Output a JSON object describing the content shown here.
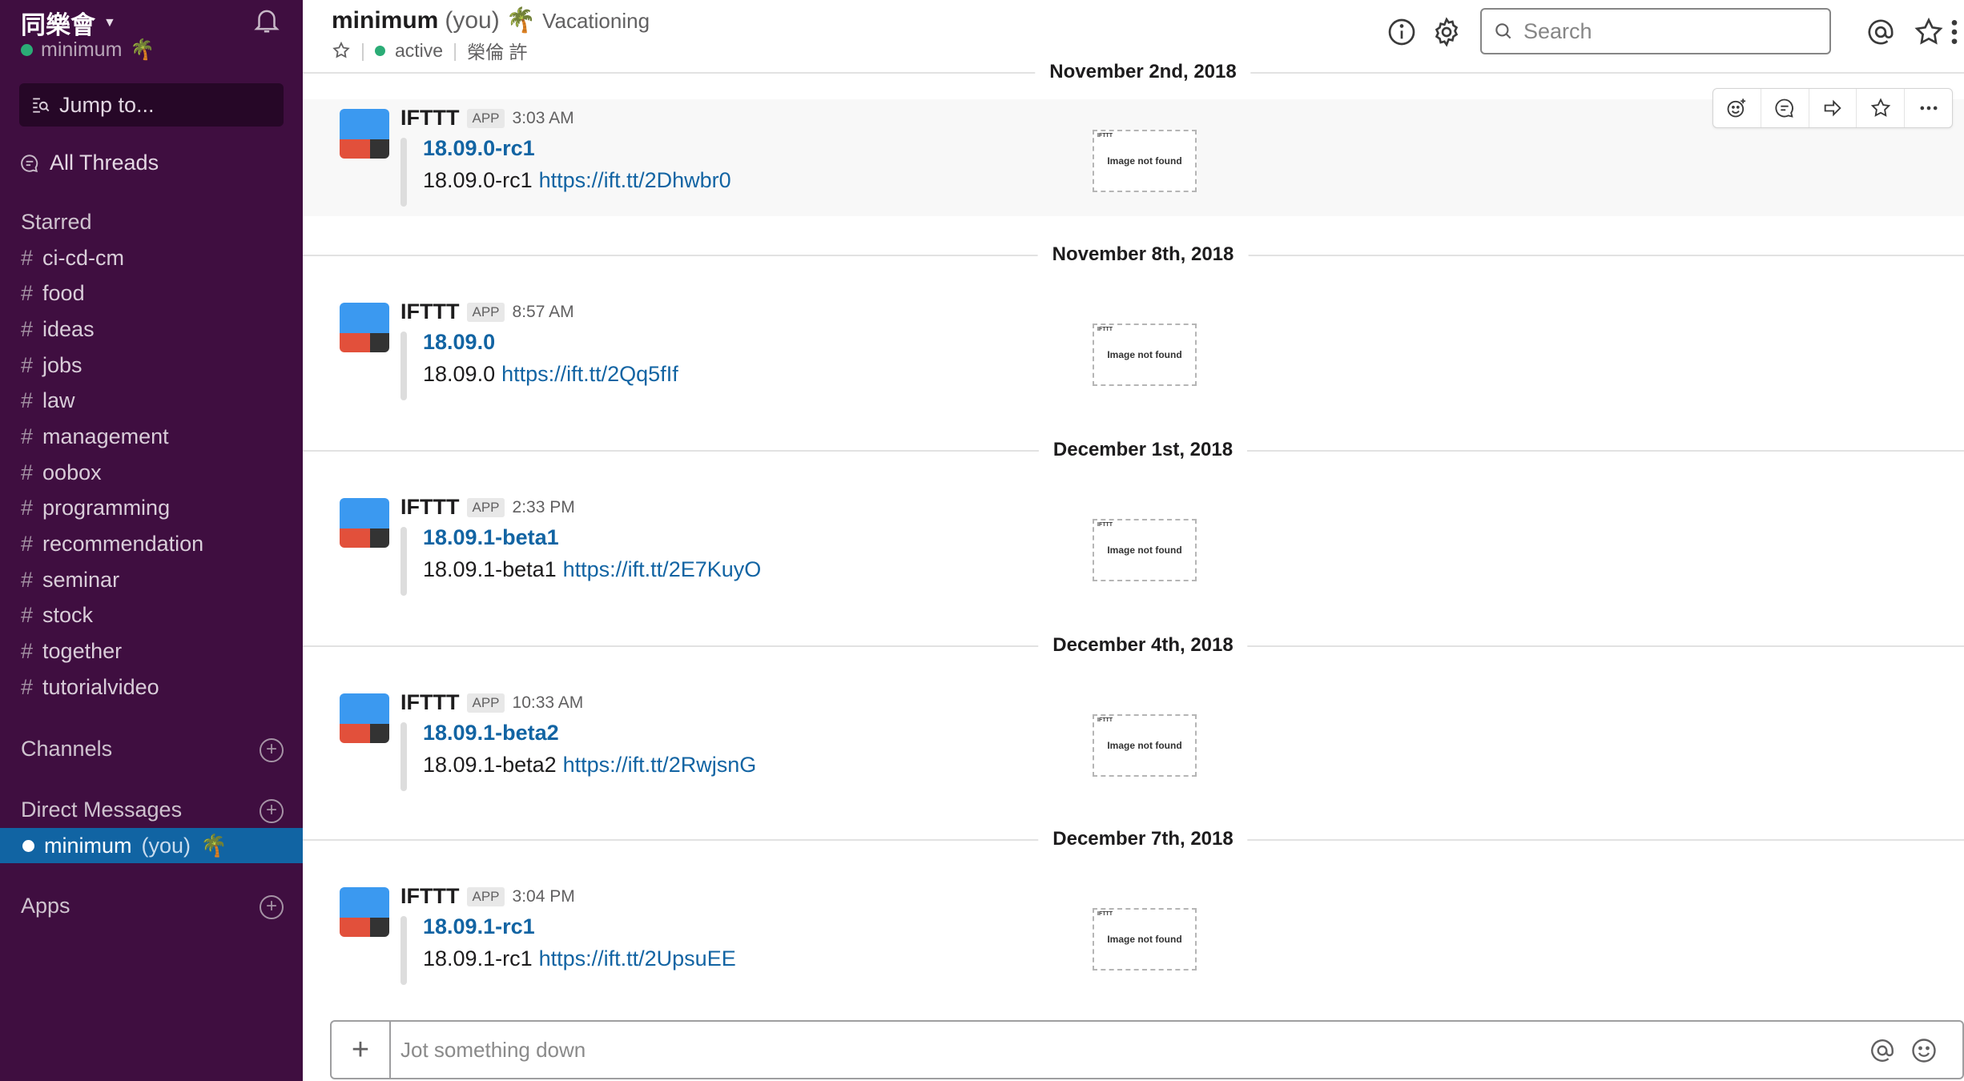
{
  "sidebar": {
    "team_name": "同樂會",
    "user": "minimum",
    "user_emoji": "🌴",
    "jump_to": "Jump to...",
    "all_threads": "All Threads",
    "starred_title": "Starred",
    "starred_channels": [
      "ci-cd-cm",
      "food",
      "ideas",
      "jobs",
      "law",
      "management",
      "oobox",
      "programming",
      "recommendation",
      "seminar",
      "stock",
      "together",
      "tutorialvideo"
    ],
    "channels_title": "Channels",
    "dm_title": "Direct Messages",
    "dm_active_name": "minimum",
    "dm_active_you": "(you)",
    "dm_active_emoji": "🌴",
    "apps_title": "Apps",
    "colors": {
      "background": "#3f0e40",
      "active_item": "#1164a3",
      "presence": "#2bac76"
    }
  },
  "header": {
    "channel_name": "minimum",
    "you": "(you)",
    "status_emoji": "🌴",
    "status_text": "Vacationing",
    "presence": "active",
    "full_name": "榮倫 許",
    "search_placeholder": "Search"
  },
  "messages": [
    {
      "date": "November 2nd, 2018",
      "sender": "IFTTT",
      "badge": "APP",
      "time": "3:03 AM",
      "title": "18.09.0-rc1",
      "text": "18.09.0-rc1",
      "link": "https://ift.tt/2Dhwbr0",
      "thumb_corner": "IFTTT",
      "thumb_text": "Image not found"
    },
    {
      "date": "November 8th, 2018",
      "sender": "IFTTT",
      "badge": "APP",
      "time": "8:57 AM",
      "title": "18.09.0",
      "text": "18.09.0",
      "link": "https://ift.tt/2Qq5fIf",
      "thumb_corner": "IFTTT",
      "thumb_text": "Image not found"
    },
    {
      "date": "December 1st, 2018",
      "sender": "IFTTT",
      "badge": "APP",
      "time": "2:33 PM",
      "title": "18.09.1-beta1",
      "text": "18.09.1-beta1",
      "link": "https://ift.tt/2E7KuyO",
      "thumb_corner": "IFTTT",
      "thumb_text": "Image not found"
    },
    {
      "date": "December 4th, 2018",
      "sender": "IFTTT",
      "badge": "APP",
      "time": "10:33 AM",
      "title": "18.09.1-beta2",
      "text": "18.09.1-beta2",
      "link": "https://ift.tt/2RwjsnG",
      "thumb_corner": "IFTTT",
      "thumb_text": "Image not found"
    },
    {
      "date": "December 7th, 2018",
      "sender": "IFTTT",
      "badge": "APP",
      "time": "3:04 PM",
      "title": "18.09.1-rc1",
      "text": "18.09.1-rc1",
      "link": "https://ift.tt/2UpsuEE",
      "thumb_corner": "IFTTT",
      "thumb_text": "Image not found"
    }
  ],
  "composer": {
    "placeholder": "Jot something down"
  },
  "colors": {
    "link": "#1264a3",
    "avatar_blue": "#3b99f0",
    "avatar_red": "#e2503b"
  }
}
